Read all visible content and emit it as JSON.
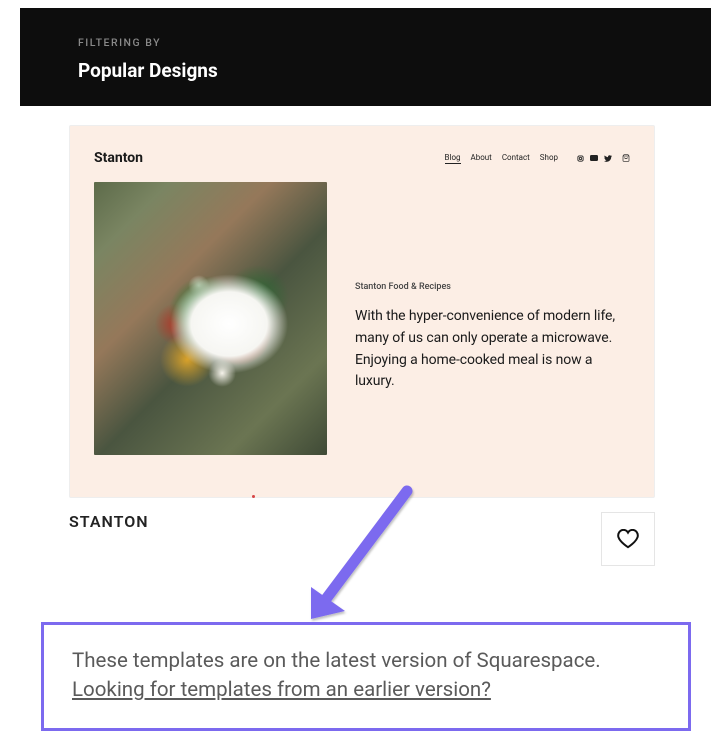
{
  "header": {
    "filtering_label": "FILTERING BY",
    "filter_title": "Popular Designs"
  },
  "template": {
    "logo": "Stanton",
    "nav": [
      "Blog",
      "About",
      "Contact",
      "Shop"
    ],
    "subheading": "Stanton Food & Recipes",
    "description": "With the hyper-convenience of modern life, many of us can only operate a microwave. Enjoying a home-cooked meal is now a luxury.",
    "name": "STANTON"
  },
  "notice": {
    "text": "These templates are on the latest version of Squarespace.",
    "link_text": "Looking for templates from an earlier version?"
  }
}
